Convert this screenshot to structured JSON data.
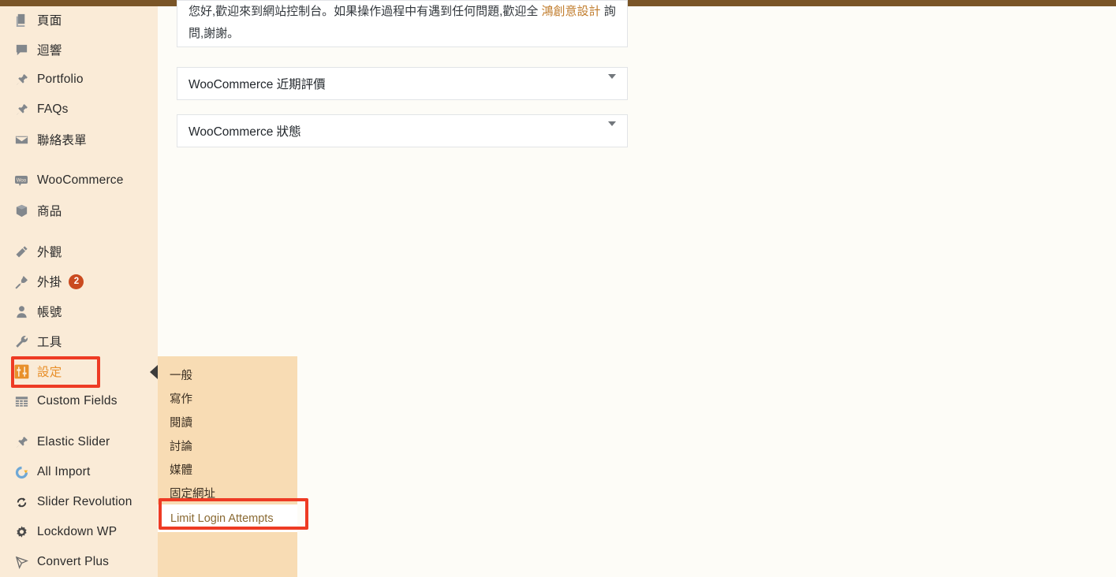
{
  "colors": {
    "admin_bar": "#7A5527",
    "sidebar_bg": "#FAEBD7",
    "submenu_bg": "#F8DCB4",
    "content_bg": "#FDFCF7",
    "highlight_border": "#EE3B24",
    "current_item_text": "#E8902B",
    "badge_bg": "#CA4A1F",
    "link_text": "#C07B2A"
  },
  "sidebar": {
    "items": [
      {
        "label": "",
        "icon": "comments-icon",
        "partial": true
      },
      {
        "label": "頁面",
        "icon": "pages-icon"
      },
      {
        "label": "迴響",
        "icon": "comment-bubble-icon"
      },
      {
        "label": "Portfolio",
        "icon": "pin-icon"
      },
      {
        "label": "FAQs",
        "icon": "pin-icon"
      },
      {
        "label": "聯絡表單",
        "icon": "envelope-icon"
      },
      {
        "label": "WooCommerce",
        "icon": "woocommerce-icon"
      },
      {
        "label": "商品",
        "icon": "box-icon"
      },
      {
        "label": "外觀",
        "icon": "brush-icon"
      },
      {
        "label": "外掛",
        "icon": "plug-icon",
        "badge": "2"
      },
      {
        "label": "帳號",
        "icon": "user-icon"
      },
      {
        "label": "工具",
        "icon": "wrench-icon"
      },
      {
        "label": "設定",
        "icon": "settings-sliders-icon",
        "current": true,
        "highlighted": true
      },
      {
        "label": "Custom Fields",
        "icon": "table-grid-icon"
      },
      {
        "label": "Elastic Slider",
        "icon": "pin-icon"
      },
      {
        "label": "All Import",
        "icon": "all-import-logo-icon"
      },
      {
        "label": "Slider Revolution",
        "icon": "refresh-circle-icon"
      },
      {
        "label": "Lockdown WP",
        "icon": "gear-icon"
      },
      {
        "label": "Convert Plus",
        "icon": "paper-plane-icon"
      }
    ]
  },
  "submenu": {
    "items": [
      {
        "label": "一般"
      },
      {
        "label": "寫作"
      },
      {
        "label": "閱讀"
      },
      {
        "label": "討論"
      },
      {
        "label": "媒體"
      },
      {
        "label": "固定網址"
      },
      {
        "label": "Limit Login Attempts",
        "active": true,
        "highlighted": true
      }
    ]
  },
  "content": {
    "welcome": {
      "text_before": "您好,歡迎來到網站控制台。如果操作過程中有遇到任何問題,歡迎全",
      "link": "鴻創意設計",
      "text_after": "詢問,謝謝。"
    },
    "panels": [
      {
        "title": "WooCommerce 近期評價",
        "toggle": "chevron-down-icon"
      },
      {
        "title": "WooCommerce 狀態",
        "toggle": "chevron-down-icon"
      }
    ]
  }
}
